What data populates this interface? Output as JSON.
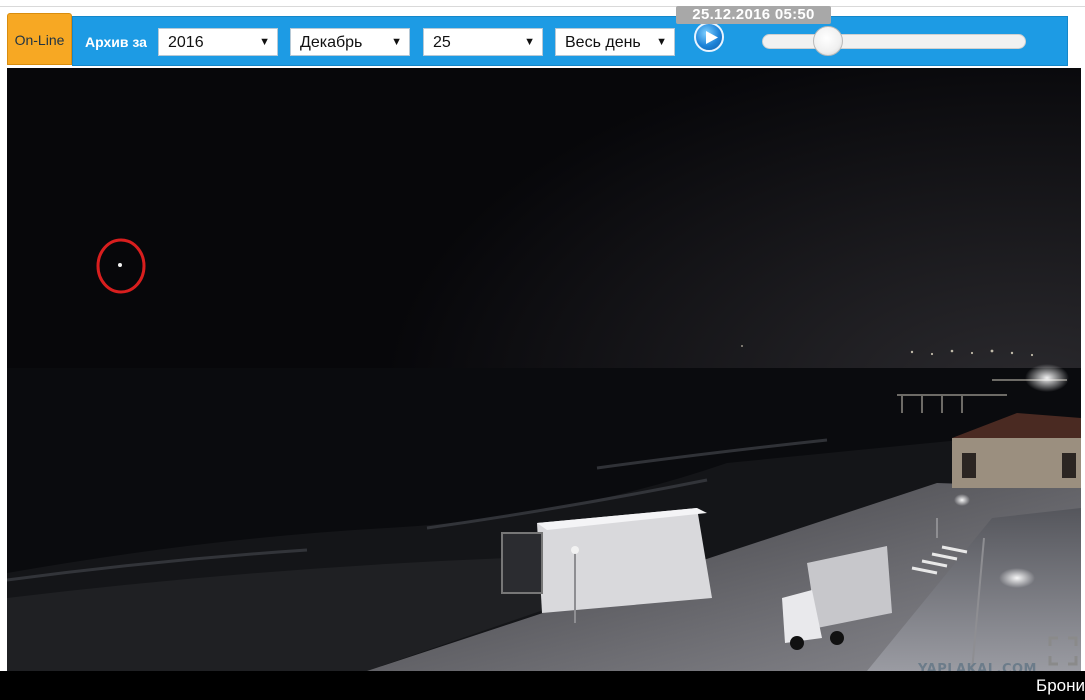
{
  "toolbar": {
    "online_label": "On-Line",
    "archive_label": "Архив за",
    "year": {
      "selected": "2016"
    },
    "month": {
      "selected": "Декабрь"
    },
    "day": {
      "selected": "25"
    },
    "period": {
      "selected": "Весь день"
    },
    "arrow_glyph": "▼",
    "timestamp": "25.12.2016 05:50",
    "timeline_position": 0.25
  },
  "video": {
    "watermark": "YAPLAKAL.COM"
  },
  "footer": {
    "booking_label": "Брони"
  },
  "colors": {
    "toolbar_bg": "#1d9be4",
    "online_bg": "#f7a823",
    "highlight_circle": "#d81e1e"
  }
}
